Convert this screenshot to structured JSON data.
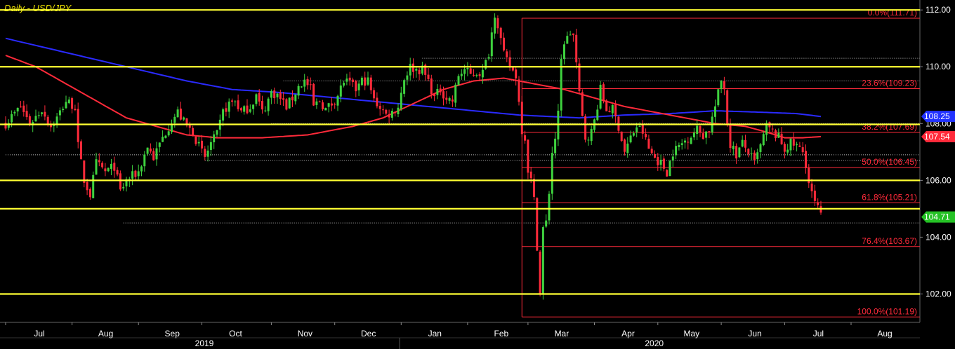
{
  "title": "Daily - USD/JPY",
  "colors": {
    "background": "#000000",
    "up_candle": "#3ed23e",
    "down_candle": "#ff2a3a",
    "ma_red": "#ff2a3a",
    "ma_blue": "#2a2aff",
    "support_resistance": "#ffff33",
    "fib": "#ff2a3a",
    "title": "#f2e600",
    "axis_text": "#ffffff",
    "last_price_box": "#25c225",
    "blue_box": "#2233ff",
    "red_box": "#ff2a3a"
  },
  "chart_data": {
    "type": "candlestick",
    "ylim": [
      101.0,
      112.35
    ],
    "y_ticks": [
      102.0,
      104.0,
      106.0,
      108.0,
      110.0,
      112.0
    ],
    "y_tick_labels": [
      "102.00",
      "104.00",
      "106.00",
      "108.00",
      "110.00",
      "112.00"
    ],
    "months": [
      {
        "label": "Jul",
        "i": 0
      },
      {
        "label": "Aug",
        "i": 22
      },
      {
        "label": "Sep",
        "i": 44
      },
      {
        "label": "Oct",
        "i": 65
      },
      {
        "label": "Nov",
        "i": 88
      },
      {
        "label": "Dec",
        "i": 109
      },
      {
        "label": "Jan",
        "i": 131
      },
      {
        "label": "Feb",
        "i": 153
      },
      {
        "label": "Mar",
        "i": 173
      },
      {
        "label": "Apr",
        "i": 195
      },
      {
        "label": "May",
        "i": 216
      },
      {
        "label": "Jun",
        "i": 237
      },
      {
        "label": "Jul",
        "i": 258
      },
      {
        "label": "Aug",
        "i": 280
      }
    ],
    "years": [
      {
        "label": "2019",
        "i": 60
      },
      {
        "label": "2020",
        "i": 209
      }
    ],
    "year_divider_i": 120,
    "n_days": 290,
    "last_index": 270,
    "close_anchors": [
      [
        0,
        108.0
      ],
      [
        5,
        108.6
      ],
      [
        8,
        108.0
      ],
      [
        12,
        108.5
      ],
      [
        15,
        107.9
      ],
      [
        17,
        108.2
      ],
      [
        20,
        108.8
      ],
      [
        23,
        108.6
      ],
      [
        24,
        107.2
      ],
      [
        26,
        106.0
      ],
      [
        28,
        105.5
      ],
      [
        30,
        106.6
      ],
      [
        33,
        106.3
      ],
      [
        36,
        106.5
      ],
      [
        38,
        105.6
      ],
      [
        40,
        106.0
      ],
      [
        44,
        106.3
      ],
      [
        47,
        107.2
      ],
      [
        49,
        106.8
      ],
      [
        52,
        107.5
      ],
      [
        55,
        108.1
      ],
      [
        57,
        108.4
      ],
      [
        60,
        107.9
      ],
      [
        62,
        107.7
      ],
      [
        64,
        107.2
      ],
      [
        66,
        106.8
      ],
      [
        68,
        107.3
      ],
      [
        70,
        107.6
      ],
      [
        72,
        108.4
      ],
      [
        74,
        108.7
      ],
      [
        76,
        108.8
      ],
      [
        78,
        108.4
      ],
      [
        81,
        108.6
      ],
      [
        83,
        109.0
      ],
      [
        85,
        108.4
      ],
      [
        86,
        108.6
      ],
      [
        88,
        109.1
      ],
      [
        90,
        109.0
      ],
      [
        93,
        108.6
      ],
      [
        95,
        108.9
      ],
      [
        97,
        109.3
      ],
      [
        99,
        109.5
      ],
      [
        101,
        109.2
      ],
      [
        102,
        108.6
      ],
      [
        104,
        108.8
      ],
      [
        106,
        108.5
      ],
      [
        108,
        108.7
      ],
      [
        110,
        109.0
      ],
      [
        112,
        109.5
      ],
      [
        114,
        109.4
      ],
      [
        116,
        109.2
      ],
      [
        118,
        109.5
      ],
      [
        120,
        109.5
      ],
      [
        122,
        108.8
      ],
      [
        124,
        108.6
      ],
      [
        126,
        108.3
      ],
      [
        128,
        108.4
      ],
      [
        130,
        108.6
      ],
      [
        132,
        109.6
      ],
      [
        134,
        110.0
      ],
      [
        136,
        109.9
      ],
      [
        138,
        109.9
      ],
      [
        140,
        109.5
      ],
      [
        142,
        108.9
      ],
      [
        144,
        109.2
      ],
      [
        146,
        108.9
      ],
      [
        148,
        108.8
      ],
      [
        150,
        109.7
      ],
      [
        152,
        109.9
      ],
      [
        154,
        109.7
      ],
      [
        156,
        109.8
      ],
      [
        158,
        109.8
      ],
      [
        160,
        110.5
      ],
      [
        162,
        111.9
      ],
      [
        163,
        111.5
      ],
      [
        165,
        110.4
      ],
      [
        167,
        110.0
      ],
      [
        169,
        109.7
      ],
      [
        171,
        107.8
      ],
      [
        172,
        107.5
      ],
      [
        173,
        106.4
      ],
      [
        174,
        106.0
      ],
      [
        175,
        105.3
      ],
      [
        176,
        103.7
      ],
      [
        177,
        102.0
      ],
      [
        178,
        104.3
      ],
      [
        179,
        104.5
      ],
      [
        180,
        105.6
      ],
      [
        181,
        107.0
      ],
      [
        182,
        107.5
      ],
      [
        183,
        108.3
      ],
      [
        184,
        110.2
      ],
      [
        185,
        110.9
      ],
      [
        186,
        111.0
      ],
      [
        187,
        111.2
      ],
      [
        188,
        111.1
      ],
      [
        189,
        110.1
      ],
      [
        190,
        109.0
      ],
      [
        191,
        108.2
      ],
      [
        192,
        107.5
      ],
      [
        194,
        107.7
      ],
      [
        195,
        108.1
      ],
      [
        197,
        109.2
      ],
      [
        199,
        108.5
      ],
      [
        201,
        108.5
      ],
      [
        203,
        107.9
      ],
      [
        205,
        107.0
      ],
      [
        207,
        107.5
      ],
      [
        209,
        107.9
      ],
      [
        211,
        107.7
      ],
      [
        213,
        107.1
      ],
      [
        215,
        106.8
      ],
      [
        217,
        106.6
      ],
      [
        219,
        106.3
      ],
      [
        221,
        107.0
      ],
      [
        223,
        107.2
      ],
      [
        225,
        107.4
      ],
      [
        227,
        107.6
      ],
      [
        229,
        107.8
      ],
      [
        231,
        107.6
      ],
      [
        233,
        107.8
      ],
      [
        235,
        108.6
      ],
      [
        237,
        109.5
      ],
      [
        238,
        109.3
      ],
      [
        239,
        108.0
      ],
      [
        240,
        107.3
      ],
      [
        242,
        106.9
      ],
      [
        244,
        107.3
      ],
      [
        246,
        107.0
      ],
      [
        248,
        106.6
      ],
      [
        250,
        107.2
      ],
      [
        252,
        107.9
      ],
      [
        254,
        107.7
      ],
      [
        256,
        107.5
      ],
      [
        258,
        107.1
      ],
      [
        260,
        107.3
      ],
      [
        262,
        107.2
      ],
      [
        264,
        107.0
      ],
      [
        265,
        106.6
      ],
      [
        266,
        105.9
      ],
      [
        267,
        105.5
      ],
      [
        268,
        105.2
      ],
      [
        269,
        105.0
      ],
      [
        270,
        104.71
      ]
    ],
    "ma_blue_anchors": [
      [
        0,
        111.0
      ],
      [
        20,
        110.5
      ],
      [
        40,
        110.0
      ],
      [
        60,
        109.5
      ],
      [
        75,
        109.2
      ],
      [
        90,
        109.1
      ],
      [
        110,
        108.9
      ],
      [
        130,
        108.7
      ],
      [
        150,
        108.5
      ],
      [
        170,
        108.3
      ],
      [
        190,
        108.2
      ],
      [
        205,
        108.3
      ],
      [
        220,
        108.35
      ],
      [
        235,
        108.45
      ],
      [
        250,
        108.4
      ],
      [
        262,
        108.35
      ],
      [
        270,
        108.25
      ]
    ],
    "ma_red_anchors": [
      [
        0,
        110.4
      ],
      [
        10,
        110.0
      ],
      [
        20,
        109.4
      ],
      [
        30,
        108.8
      ],
      [
        40,
        108.2
      ],
      [
        50,
        107.9
      ],
      [
        60,
        107.6
      ],
      [
        70,
        107.5
      ],
      [
        85,
        107.5
      ],
      [
        100,
        107.6
      ],
      [
        115,
        107.9
      ],
      [
        125,
        108.2
      ],
      [
        135,
        108.7
      ],
      [
        145,
        109.2
      ],
      [
        155,
        109.5
      ],
      [
        165,
        109.6
      ],
      [
        175,
        109.4
      ],
      [
        185,
        109.2
      ],
      [
        195,
        108.9
      ],
      [
        205,
        108.6
      ],
      [
        215,
        108.4
      ],
      [
        225,
        108.2
      ],
      [
        235,
        108.0
      ],
      [
        245,
        107.9
      ],
      [
        252,
        107.7
      ],
      [
        258,
        107.5
      ],
      [
        264,
        107.5
      ],
      [
        270,
        107.54
      ]
    ],
    "horizontal_levels": [
      112.0,
      110.0,
      107.97,
      106.0,
      105.0,
      102.0
    ],
    "dotted_levels": [
      {
        "value": 110.3,
        "from_i": 138
      },
      {
        "value": 109.5,
        "from_i": 92
      },
      {
        "value": 108.0,
        "from_i": 88
      },
      {
        "value": 106.9,
        "from_i": 0
      },
      {
        "value": 106.7,
        "from_i": 66
      },
      {
        "value": 104.5,
        "from_i": 39
      }
    ],
    "fib_start_i": 171,
    "fib_levels": [
      {
        "value": 111.71,
        "label": "0.0%(111.71)"
      },
      {
        "value": 109.23,
        "label": "23.6%(109.23)"
      },
      {
        "value": 107.69,
        "label": "38.2%(107.69)"
      },
      {
        "value": 106.45,
        "label": "50.0%(106.45)"
      },
      {
        "value": 105.21,
        "label": "61.8%(105.21)"
      },
      {
        "value": 103.67,
        "label": "76.4%(103.67)"
      },
      {
        "value": 101.19,
        "label": "100.0%(101.19)"
      }
    ],
    "price_boxes": [
      {
        "value": 108.25,
        "label": "108.25",
        "color": "blue"
      },
      {
        "value": 107.54,
        "label": "107.54",
        "color": "red"
      },
      {
        "value": 104.71,
        "label": "104.71",
        "color": "green"
      }
    ]
  }
}
